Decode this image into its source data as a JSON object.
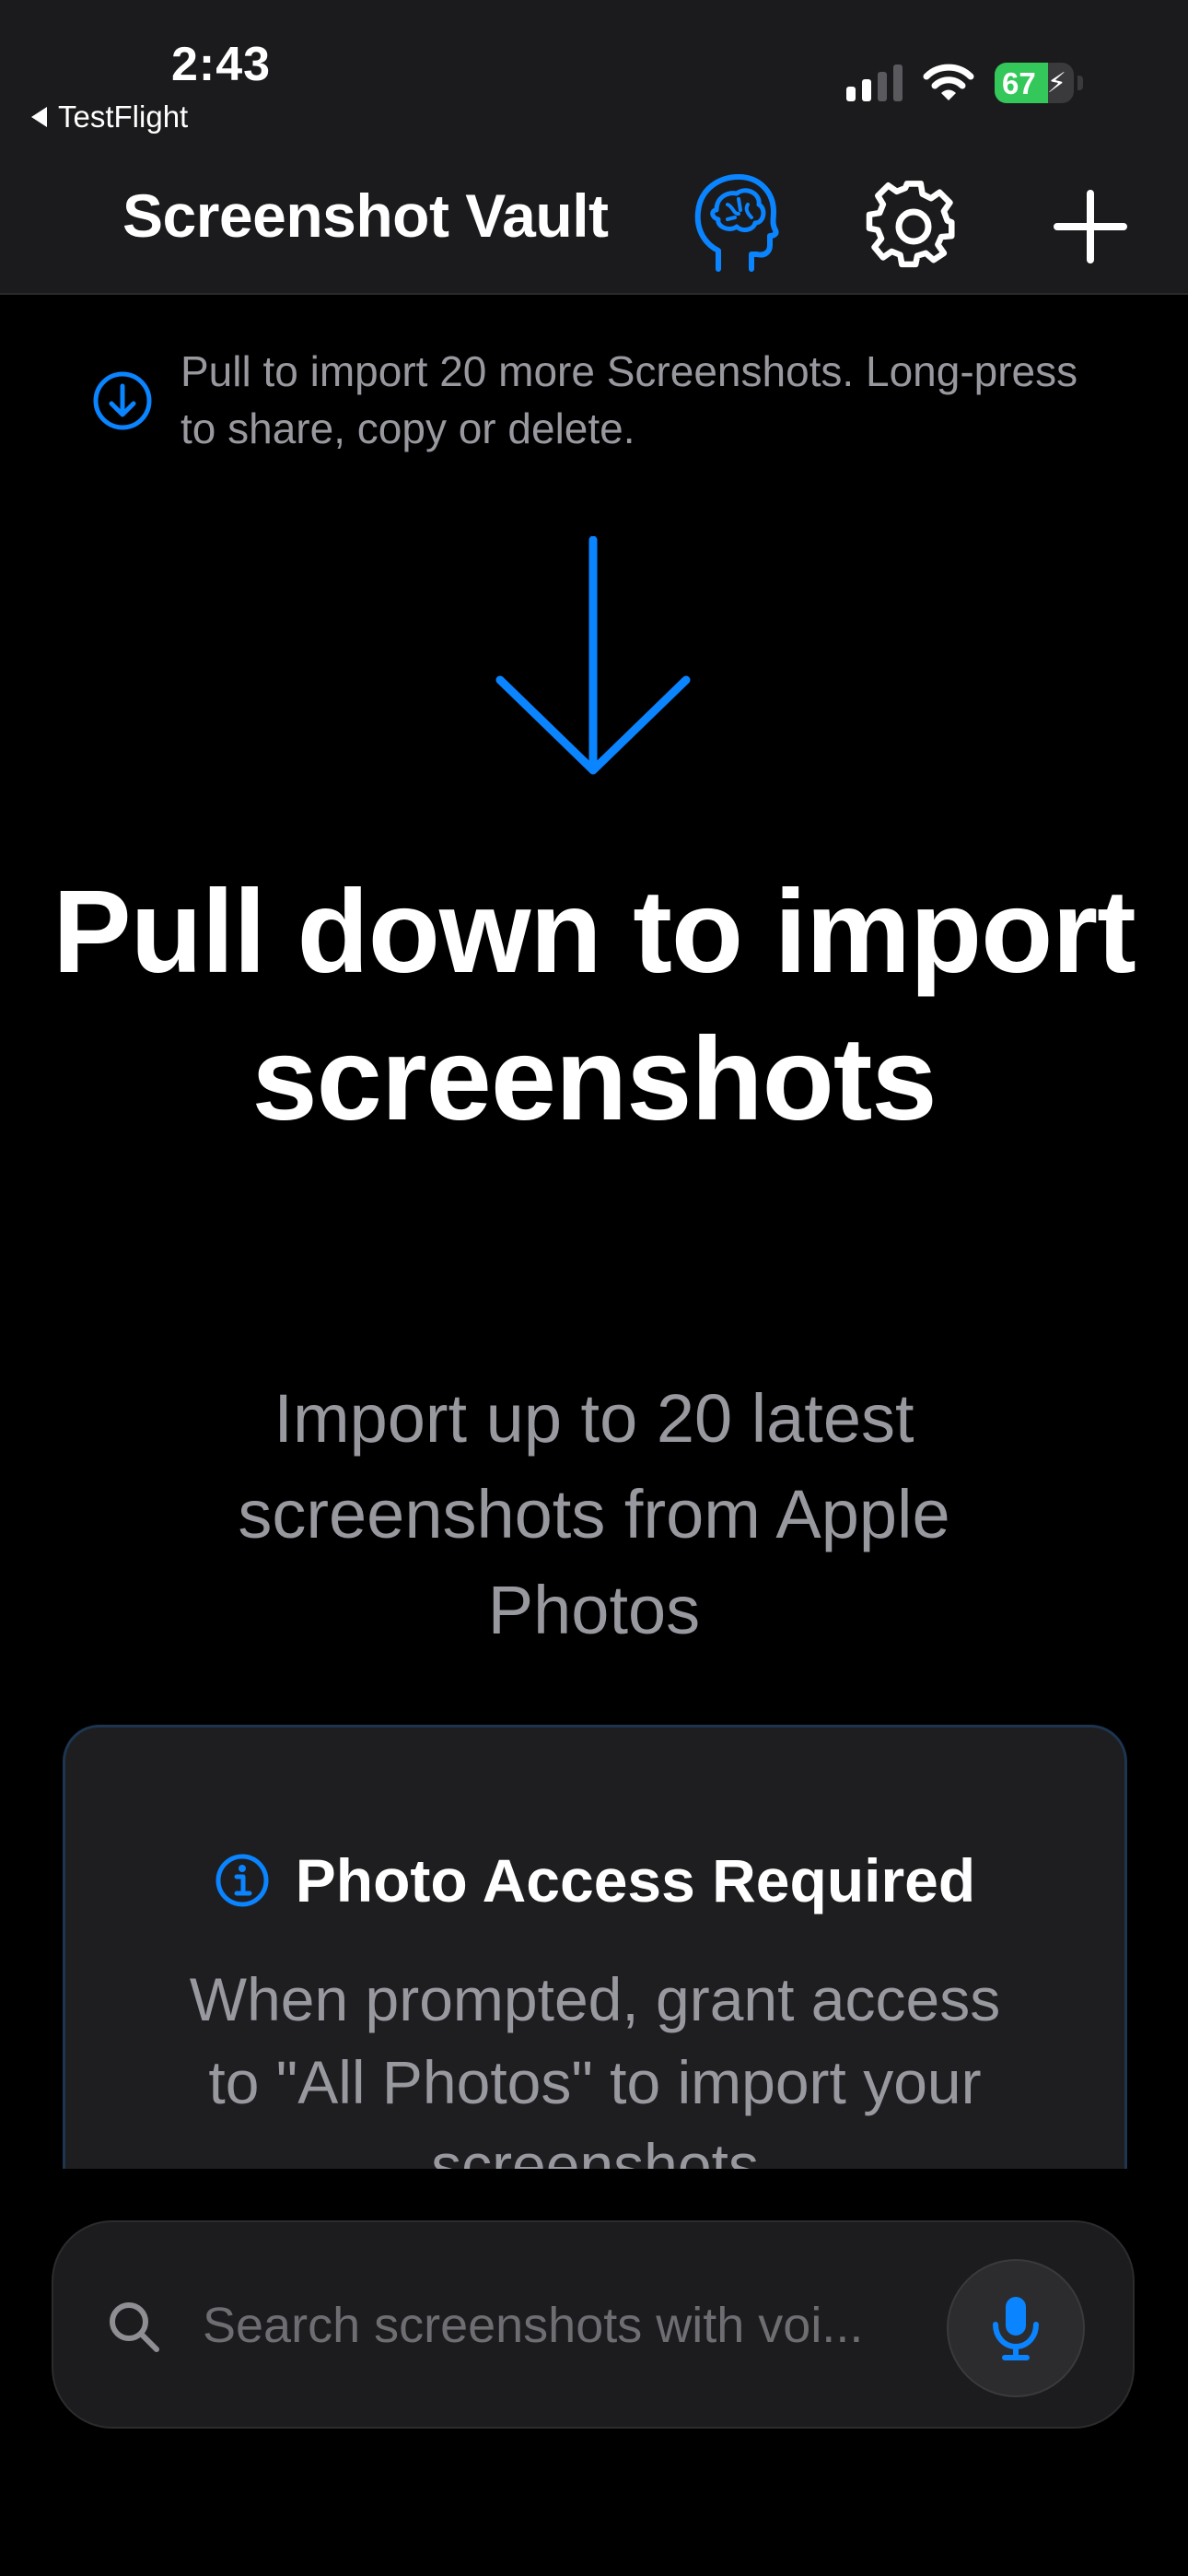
{
  "status_bar": {
    "time": "2:43",
    "back_app_label": "TestFlight",
    "battery_percent": "67",
    "battery_charging": true,
    "signal_bars_active": 2,
    "signal_bars_total": 4
  },
  "nav": {
    "title": "Screenshot Vault",
    "icons": [
      "brain-head-icon",
      "gear-icon",
      "plus-icon"
    ]
  },
  "hint": {
    "icon": "arrow-down-circle-icon",
    "text": "Pull to import 20 more Screenshots. Long-press to share, copy or delete."
  },
  "empty_state": {
    "icon": "arrow-down-icon",
    "headline": "Pull down to import screenshots",
    "subline": "Import up to 20 latest screenshots from Apple Photos"
  },
  "access_card": {
    "icon": "info-circle-icon",
    "title": "Photo Access Required",
    "body": "When prompted, grant access to \"All Photos\" to import your screenshots"
  },
  "search": {
    "placeholder": "Search screenshots with voi...",
    "value": "",
    "icons": [
      "search-icon",
      "microphone-icon"
    ]
  },
  "colors": {
    "accent": "#0a84ff",
    "background": "#000000",
    "bar_background": "#1b1b1d",
    "secondary_text": "#98989f",
    "battery_fill": "#34c759"
  }
}
